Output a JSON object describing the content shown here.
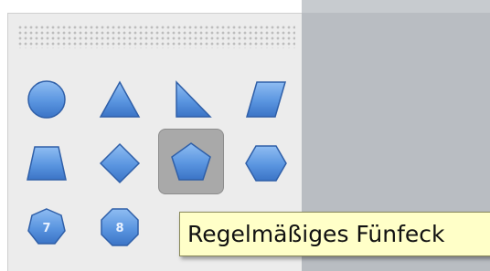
{
  "tooltip": {
    "text": "Regelmäßiges Fünfeck"
  },
  "palette": {
    "selected_shape": "pentagon",
    "shapes": [
      {
        "name": "circle",
        "row": 1
      },
      {
        "name": "triangle",
        "row": 1
      },
      {
        "name": "right-triangle",
        "row": 1
      },
      {
        "name": "parallelogram",
        "row": 1
      },
      {
        "name": "trapezoid",
        "row": 2
      },
      {
        "name": "diamond",
        "row": 2
      },
      {
        "name": "pentagon",
        "row": 2
      },
      {
        "name": "hexagon",
        "row": 2
      },
      {
        "name": "heptagon",
        "row": 3,
        "badge": "7"
      },
      {
        "name": "octagon",
        "row": 3,
        "badge": "8"
      }
    ]
  },
  "colors": {
    "shape_fill": "#5f9ae0",
    "shape_stroke": "#2f5fa8",
    "tooltip_bg": "#ffffc8",
    "selection_bg": "#a9a9a9"
  }
}
